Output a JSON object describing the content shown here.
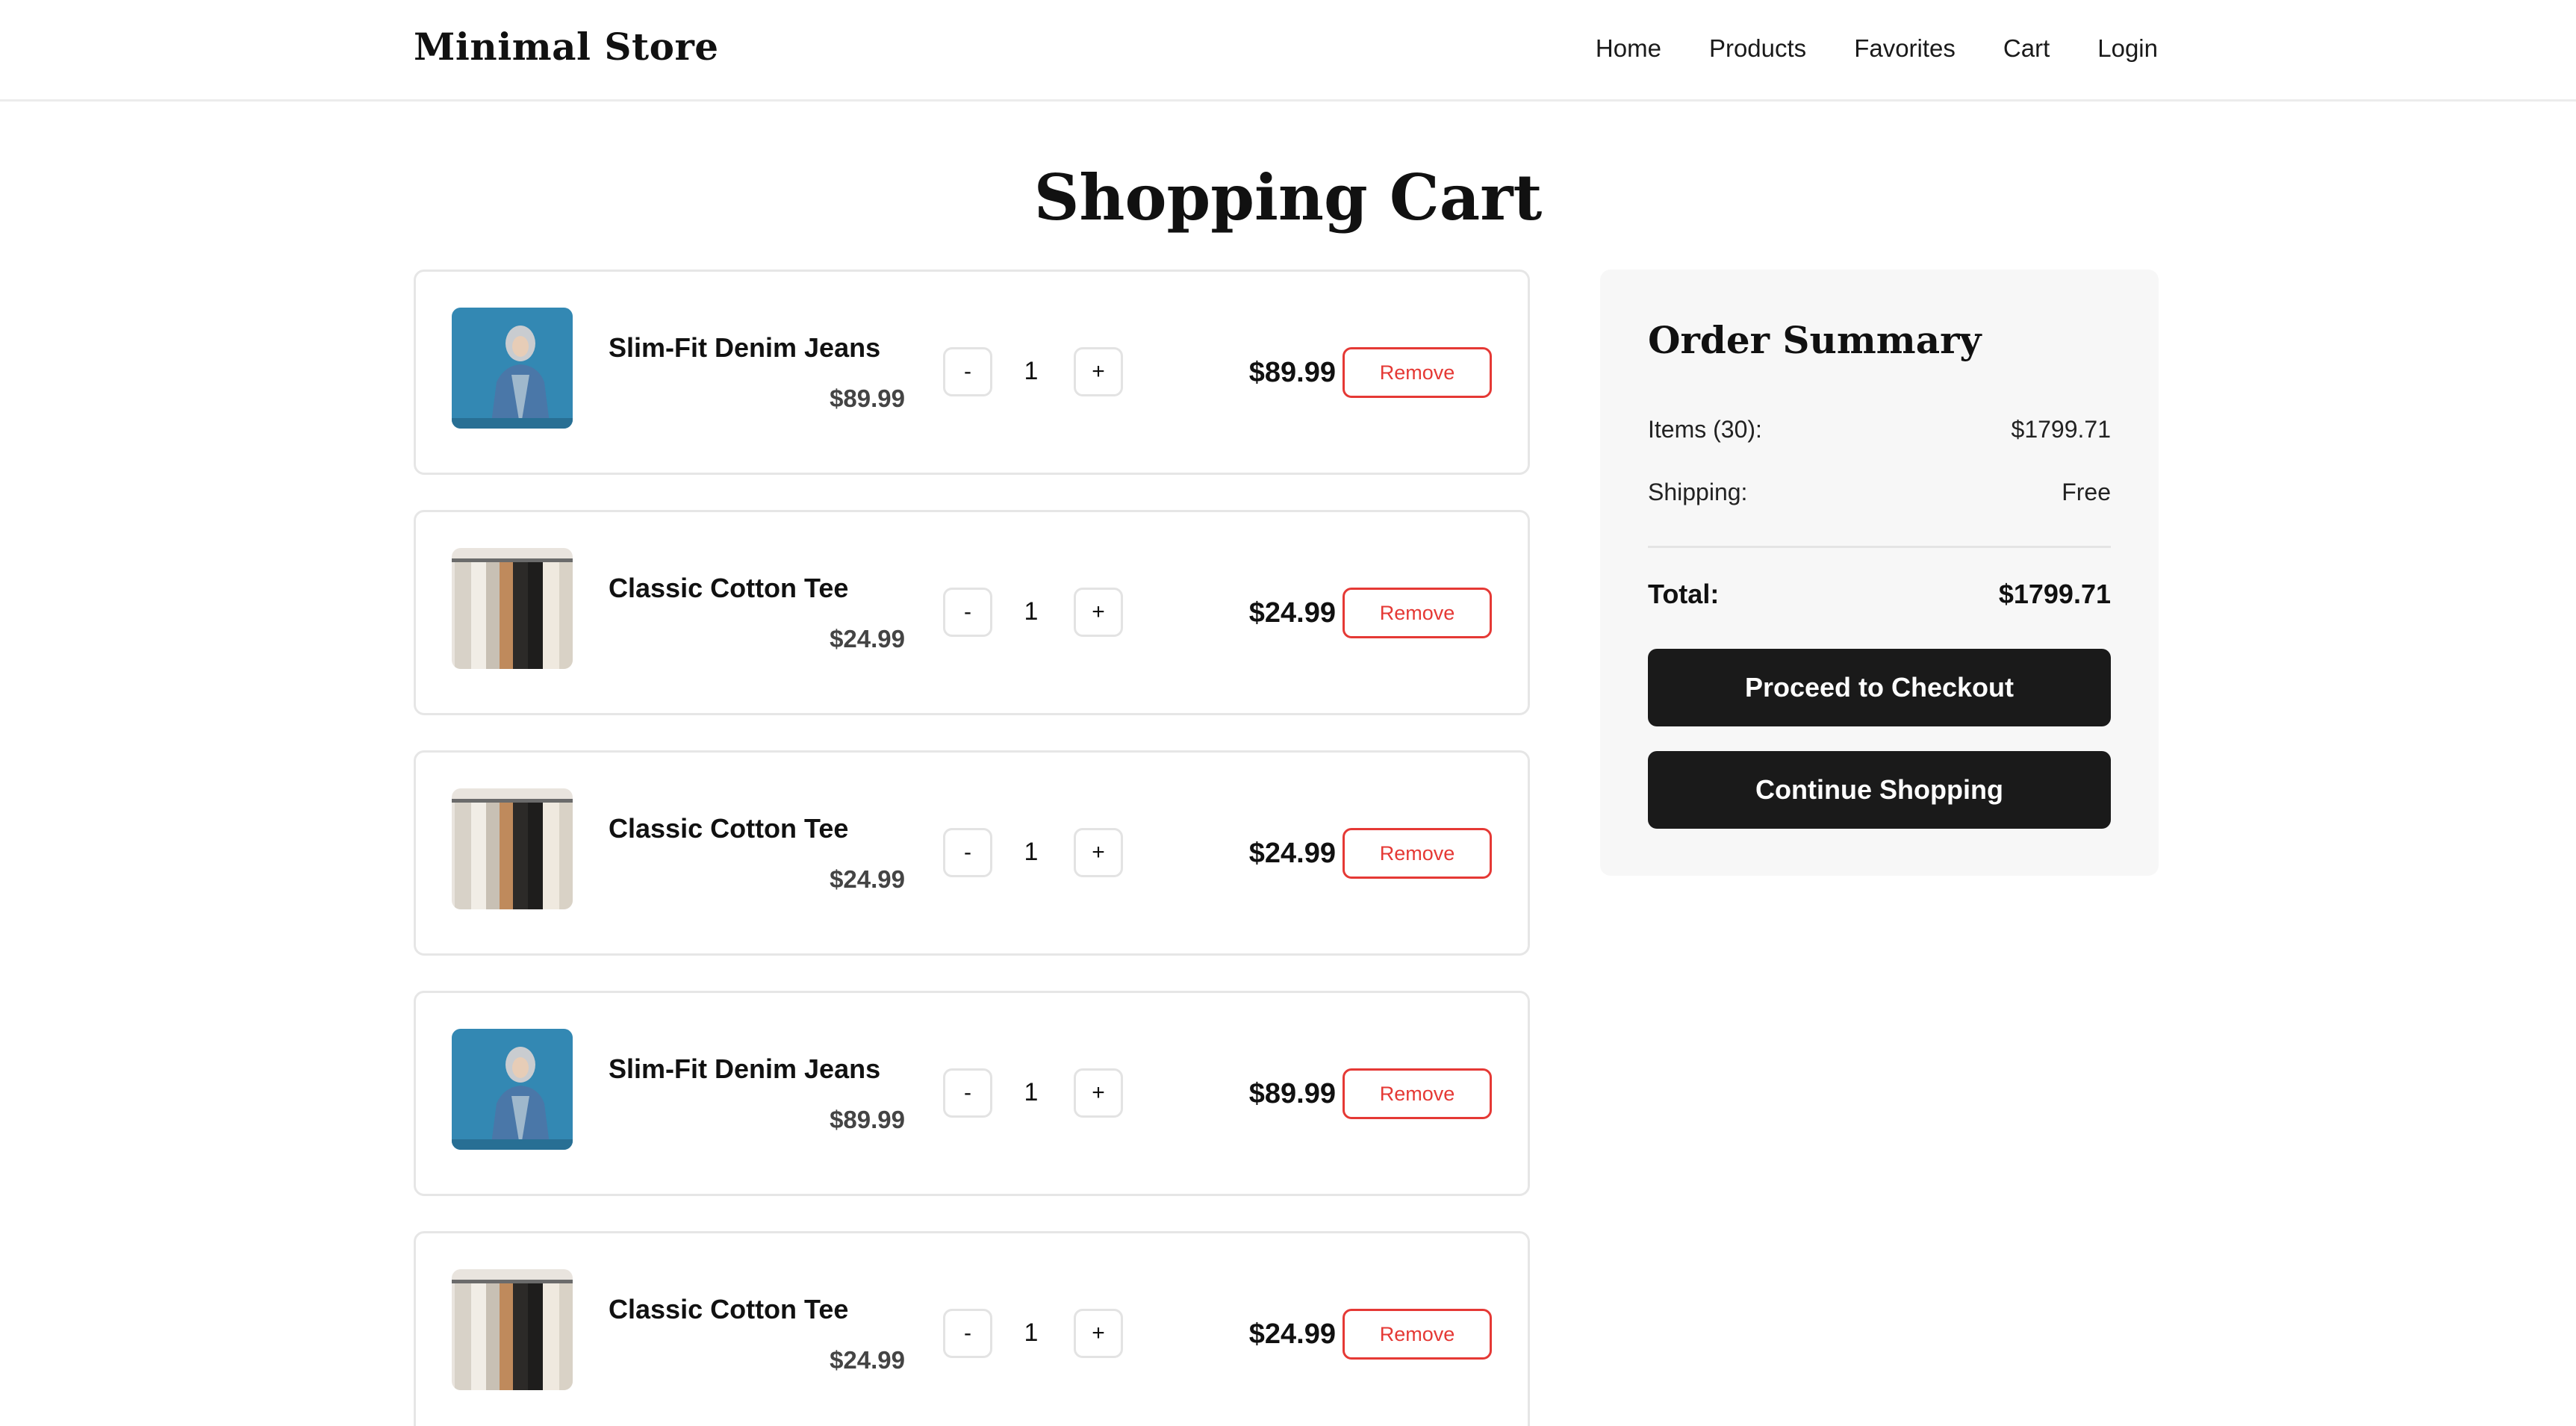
{
  "header": {
    "brand": "Minimal Store",
    "nav": [
      "Home",
      "Products",
      "Favorites",
      "Cart",
      "Login"
    ]
  },
  "page_title": "Shopping Cart",
  "cart": {
    "items": [
      {
        "name": "Slim-Fit Denim Jeans",
        "unit_price": "$89.99",
        "quantity": "1",
        "line_total": "$89.99",
        "image": "denim-jeans-photo"
      },
      {
        "name": "Classic Cotton Tee",
        "unit_price": "$24.99",
        "quantity": "1",
        "line_total": "$24.99",
        "image": "cotton-tee-rack-photo"
      },
      {
        "name": "Classic Cotton Tee",
        "unit_price": "$24.99",
        "quantity": "1",
        "line_total": "$24.99",
        "image": "cotton-tee-rack-photo"
      },
      {
        "name": "Slim-Fit Denim Jeans",
        "unit_price": "$89.99",
        "quantity": "1",
        "line_total": "$89.99",
        "image": "denim-jeans-photo"
      },
      {
        "name": "Classic Cotton Tee",
        "unit_price": "$24.99",
        "quantity": "1",
        "line_total": "$24.99",
        "image": "cotton-tee-rack-photo"
      }
    ],
    "minus_label": "-",
    "plus_label": "+",
    "remove_label": "Remove"
  },
  "summary": {
    "title": "Order Summary",
    "items_label": "Items (30):",
    "items_value": "$1799.71",
    "shipping_label": "Shipping:",
    "shipping_value": "Free",
    "total_label": "Total:",
    "total_value": "$1799.71",
    "checkout_label": "Proceed to Checkout",
    "continue_label": "Continue Shopping"
  },
  "colors": {
    "accent_dark": "#1a1a1a",
    "remove_red": "#e53935",
    "summary_bg": "#f7f7f7",
    "denim_blue": "#2f84b0"
  }
}
